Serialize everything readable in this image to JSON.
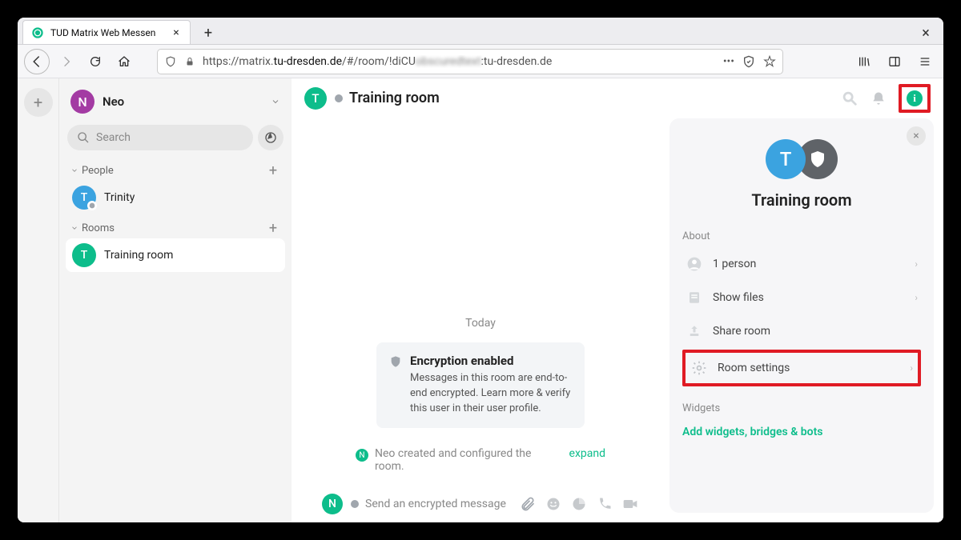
{
  "browser": {
    "tab_title": "TUD Matrix Web Messen",
    "url_prefix": "https://matrix.",
    "url_domain": "tu-dresden.de",
    "url_path": "/#/room/!diCU",
    "url_blurred": "blurred-segment",
    "url_suffix": ":tu-dresden.de"
  },
  "sidebar": {
    "user_initial": "N",
    "user_name": "Neo",
    "search_placeholder": "Search",
    "sections": {
      "people": {
        "label": "People",
        "items": [
          {
            "initial": "T",
            "name": "Trinity"
          }
        ]
      },
      "rooms": {
        "label": "Rooms",
        "items": [
          {
            "initial": "T",
            "name": "Training  room",
            "selected": true
          }
        ]
      }
    }
  },
  "room": {
    "header": {
      "initial": "T",
      "name": "Training  room"
    },
    "date_marker": "Today",
    "encryption_card": {
      "title": "Encryption enabled",
      "body": "Messages in this room are end-to-end encrypted. Learn more & verify this user in their user profile."
    },
    "event": {
      "initial": "N",
      "text": "Neo created and configured the room.",
      "expand_label": "expand"
    },
    "composer": {
      "initial": "N",
      "placeholder": "Send an encrypted message"
    }
  },
  "right_panel": {
    "title": "Training  room",
    "about_label": "About",
    "items": {
      "people": "1 person",
      "files": "Show files",
      "share": "Share room",
      "settings": "Room settings"
    },
    "widgets_label": "Widgets",
    "add_widgets": "Add widgets, bridges & bots"
  }
}
